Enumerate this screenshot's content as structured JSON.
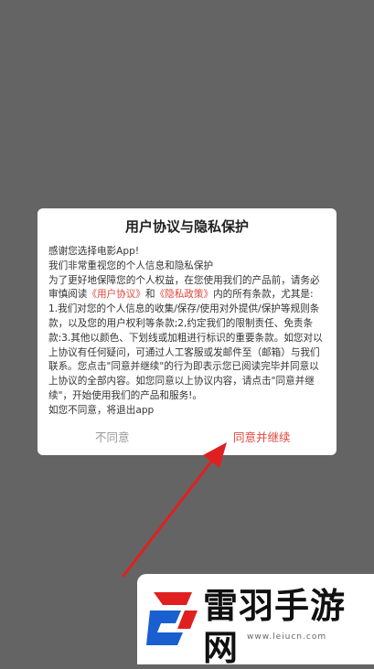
{
  "dialog": {
    "title": "用户协议与隐私保护",
    "line1": "感谢您选择电影App!",
    "line2": "我们非常重视您的个人信息和隐私保护",
    "para1_a": "为了更好地保障您的个人权益，在您使用我们的产品前，请务必审慎阅读",
    "link_user_agreement": "《用户协议》",
    "para1_and": "和",
    "link_privacy_policy": "《隐私政策》",
    "para1_b": "内的所有条款，尤其是: 1.我们对您的个人信息的收集/保存/使用对外提供/保护等规则条款，以及您的用户权利等条款;2,约定我们的限制责任、免责条款:3.其他以颜色、下划线或加粗进行标识的重要条款。如您对以上协议有任何疑问，可通过人工客服或发邮件至（邮箱）与我们联系。您点击\"同意并继续\"的行为即表示您已阅读完毕并同意以上协议的全部内容。如您同意以上协议内容，请点击\"同意并继续\"，开始使用我们的产品和服务!。",
    "line_exit": "如您不同意，将退出app",
    "btn_disagree": "不同意",
    "btn_agree": "同意并继续"
  },
  "watermark": {
    "text": "雷羽手游网",
    "url": "www.leiucn.com"
  },
  "colors": {
    "overlay": "#646464",
    "accent": "#e0463c"
  }
}
